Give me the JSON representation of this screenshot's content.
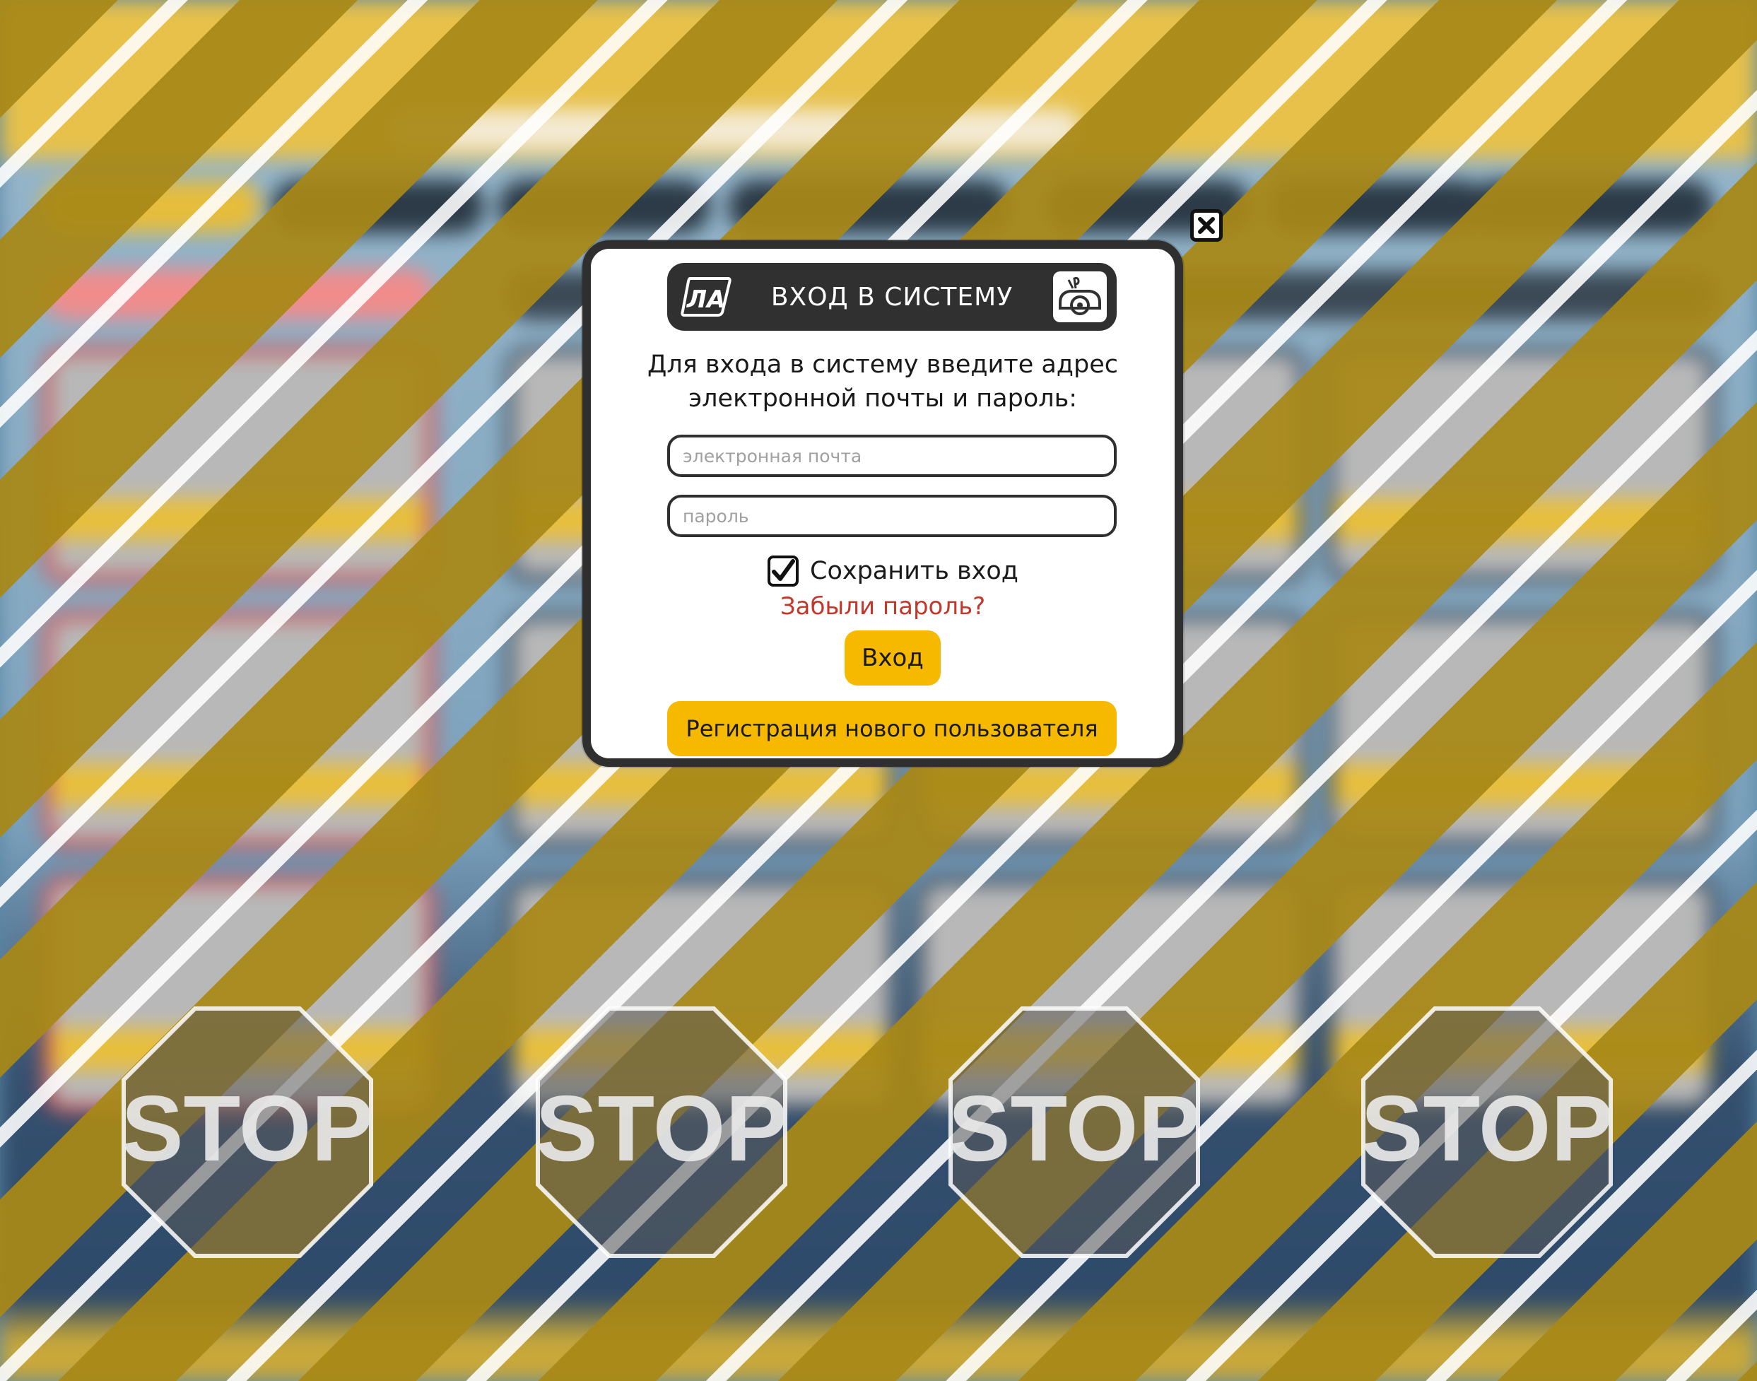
{
  "modal": {
    "title": "ВХОД В СИСТЕМУ",
    "intro_line1": "Для входа в систему введите адрес",
    "intro_line2": "электронной почты и пароль:",
    "email_placeholder": "электронная почта",
    "email_value": "",
    "password_placeholder": "пароль",
    "password_value": "",
    "remember_label": "Сохранить вход",
    "remember_checked": true,
    "forgot_password": "Забыли пароль?",
    "login_button": "Вход",
    "register_button": "Регистрация нового пользователя",
    "logo_left_text": "ЛА"
  },
  "overlay": {
    "stop_sign_text": "STOP"
  },
  "colors": {
    "accent_yellow": "#f6b900",
    "forgot_link_red": "#c0392b",
    "header_dark": "#303030",
    "stripe_gold": "#a88816"
  }
}
